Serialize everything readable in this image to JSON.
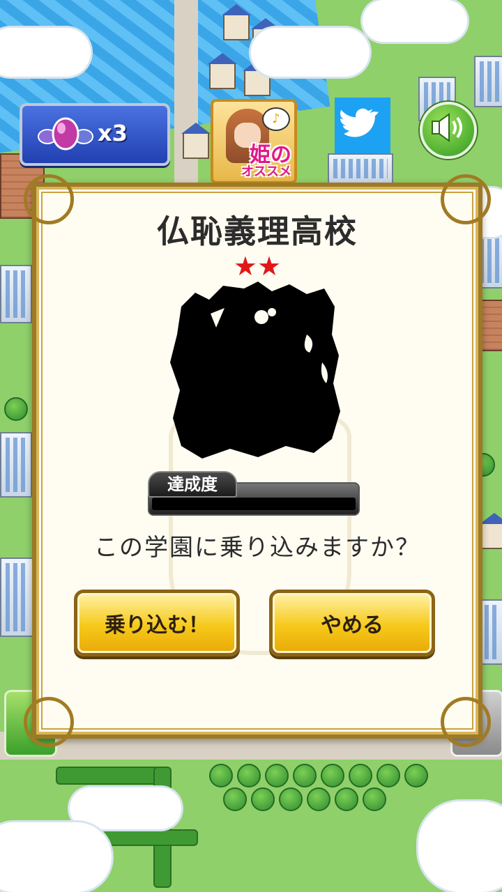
{
  "hud": {
    "gem_count": "x3",
    "hime_recommend_big": "姫の",
    "hime_recommend_small": "オススメ",
    "note_glyph": "♪"
  },
  "dialog": {
    "school_name": "仏恥義理高校",
    "stars": "★★",
    "star_count": 2,
    "progress_label": "達成度",
    "progress_value": 0,
    "question": "この学園に乗り込みますか？",
    "confirm_label": "乗り込む！",
    "cancel_label": "やめる"
  },
  "colors": {
    "accent_gold": "#f6c91a",
    "star_red": "#e01818",
    "twitter_blue": "#1da1f2",
    "gem_panel_blue": "#2240b2"
  },
  "icons": {
    "gem": "gem-icon",
    "twitter": "twitter-bird-icon",
    "sound": "speaker-icon"
  }
}
